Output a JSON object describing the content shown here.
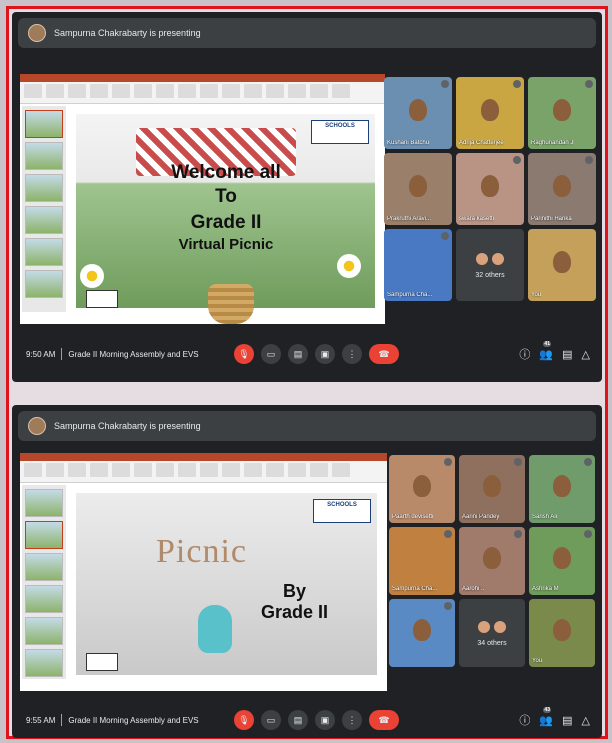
{
  "meetings": [
    {
      "presenting": "Sampurna Chakrabarty is presenting",
      "slide": {
        "logo": "SCHOOLS",
        "lines": [
          "Welcome all",
          "To",
          "Grade II",
          "Virtual Picnic"
        ]
      },
      "participants": [
        {
          "name": "Kushani Batchu",
          "bg": "#6b8fb0"
        },
        {
          "name": "Adrija Chatterjee",
          "bg": "#c9a642"
        },
        {
          "name": "Raghunandan J",
          "bg": "#7aa36a"
        },
        {
          "name": "Prakruthi Aravi...",
          "bg": "#9a7f6a"
        },
        {
          "name": "swara kasetti",
          "bg": "#b99484"
        },
        {
          "name": "Parinithi Harika",
          "bg": "#8a7a70"
        },
        {
          "name": "Sampurna Cha...",
          "bg": "#4a79c4"
        },
        {
          "name": "",
          "bg": "#3c4043",
          "others": "32 others"
        },
        {
          "name": "You",
          "bg": "#c4a05a"
        }
      ],
      "time": "9:50 AM",
      "meeting_title": "Grade II Morning Assembly and EVS",
      "participant_count": "41"
    },
    {
      "presenting": "Sampurna Chakrabarty is presenting",
      "slide": {
        "logo": "SCHOOLS",
        "lines": [
          "Picnic",
          "By",
          "Grade II"
        ]
      },
      "participants": [
        {
          "name": "Paarth devisetti",
          "bg": "#b98a6a"
        },
        {
          "name": "Aarini Pandey",
          "bg": "#8f6f5e"
        },
        {
          "name": "Sarish Ali",
          "bg": "#6f9c6a"
        },
        {
          "name": "Sampurna Cha...",
          "bg": "#c08040"
        },
        {
          "name": "Aarohi ..",
          "bg": "#a07a6a"
        },
        {
          "name": "Ashrika M",
          "bg": "#6f9c5a"
        },
        {
          "name": "",
          "bg": "#5a8ac4"
        },
        {
          "name": "",
          "bg": "#3c4043",
          "others": "34 others"
        },
        {
          "name": "You",
          "bg": "#7a8a4a"
        }
      ],
      "time": "9:55 AM",
      "meeting_title": "Grade II Morning Assembly and EVS",
      "participant_count": "43"
    }
  ]
}
